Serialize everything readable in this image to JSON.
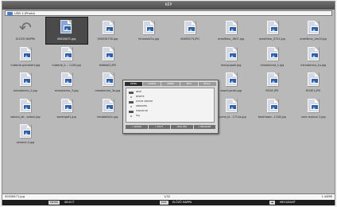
{
  "window": {
    "title": "KÉP"
  },
  "path": {
    "text": "USB 1:\\Photo\\"
  },
  "files": [
    {
      "name": "ELŐZŐ MAPPA",
      "type": "back"
    },
    {
      "name": "00028471.jpg",
      "type": "image",
      "selected": true
    },
    {
      "name": "000036735.jpg",
      "type": "image"
    },
    {
      "name": "ferrodele2a.jpg",
      "type": "image"
    },
    {
      "name": "00485275.JPG",
      "type": "image"
    },
    {
      "name": "ereeltimo_1807.jpg",
      "type": "image"
    },
    {
      "name": "ereeltimo_0731.jpg",
      "type": "image"
    },
    {
      "name": "ereeltimo_1ke1f.jpg",
      "type": "image"
    },
    {
      "name": "hubecie.pumskert.jpg",
      "type": "image"
    },
    {
      "name": "hubecie_k... 1126.jpg",
      "type": "image"
    },
    {
      "name": "foltökbl2.JPG",
      "type": "image"
    },
    {
      "name": "",
      "type": "hidden"
    },
    {
      "name": "",
      "type": "hidden"
    },
    {
      "name": "mongupadi.jpg",
      "type": "image"
    },
    {
      "name": "mirooteniro_1.jpg",
      "type": "image"
    },
    {
      "name": "mirooteniro_1a.jpg",
      "type": "image"
    },
    {
      "name": "mirooteniro_2.jpg",
      "type": "image"
    },
    {
      "name": "mirooteniro_3.jpg",
      "type": "image"
    },
    {
      "name": "mirooteniro_3a.jpg",
      "type": "image"
    },
    {
      "name": "",
      "type": "hidden"
    },
    {
      "name": "",
      "type": "hidden"
    },
    {
      "name": "vasne.jonke.jpg",
      "type": "image"
    },
    {
      "name": "ROSE.JPG",
      "type": "image"
    },
    {
      "name": "ROSE1.JPG",
      "type": "image"
    },
    {
      "name": "sakura_str...anbuk.jpg",
      "type": "image"
    },
    {
      "name": "seeenget1.jpg",
      "type": "image"
    },
    {
      "name": "tenabelle2c.jpg",
      "type": "image"
    },
    {
      "name": "tevenewhelle_3.jpg",
      "type": "image"
    },
    {
      "name": "topume_hause1.jpg",
      "type": "image"
    },
    {
      "name": "topume_ki...1711a.jpg",
      "type": "image"
    },
    {
      "name": "teoimosie...1126.jpg",
      "type": "image"
    },
    {
      "name": "urne-molsun 2.jpg",
      "type": "image"
    },
    {
      "name": "veramk-4.jpg",
      "type": "image"
    }
  ],
  "popup": {
    "tabs": [
      "KÉPEK",
      "VIDEÓK",
      "ZENÉK",
      "INFÓ",
      "BEÁLL."
    ],
    "options": [
      "NÉVE",
      "MÉRETE",
      "DÁTUM SZERINT",
      "RENDEZÉS",
      "FORMÁTUM",
      "FÁJL"
    ],
    "buttons": [
      "< LEJÁTSZ",
      "> FOLYT.",
      "LEÁLLÍTÁS",
      "< MEGSZAKÍT"
    ]
  },
  "status": {
    "filename": "00028471.jpg",
    "position": "1/32",
    "size": "1.44MB"
  },
  "keys": [
    {
      "key": "ENTER",
      "label": "SELECT"
    },
    {
      "key": "EXIT",
      "label": "ELŐZŐ MAPPA"
    },
    {
      "key": "◂▸",
      "label": "MEGSZAKÍT"
    }
  ]
}
